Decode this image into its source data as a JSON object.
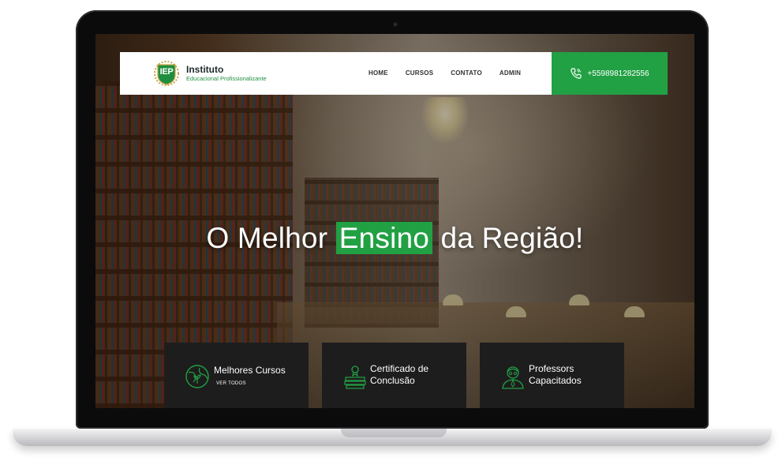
{
  "colors": {
    "brand_green": "#22a044",
    "feature_bg": "#1d1d1d"
  },
  "navbar": {
    "logo_badge": "IEP",
    "logo_name": "Instituto",
    "logo_sub": "Educacional Profissionalizante",
    "menu": [
      "HOME",
      "CURSOS",
      "CONTATO",
      "ADMIN"
    ],
    "phone_icon": "phone-icon",
    "phone": "+5598981282556"
  },
  "hero": {
    "before": "O Melhor",
    "highlight": "Ensino",
    "after": "da Região!"
  },
  "features": [
    {
      "icon": "globe-plant-icon",
      "title": "Melhores Cursos",
      "link": "VER TODOS"
    },
    {
      "icon": "certificate-books-icon",
      "title_line1": "Certificado de",
      "title_line2": "Conclusão"
    },
    {
      "icon": "teacher-icon",
      "title_line1": "Professors",
      "title_line2": "Capacitados"
    }
  ]
}
